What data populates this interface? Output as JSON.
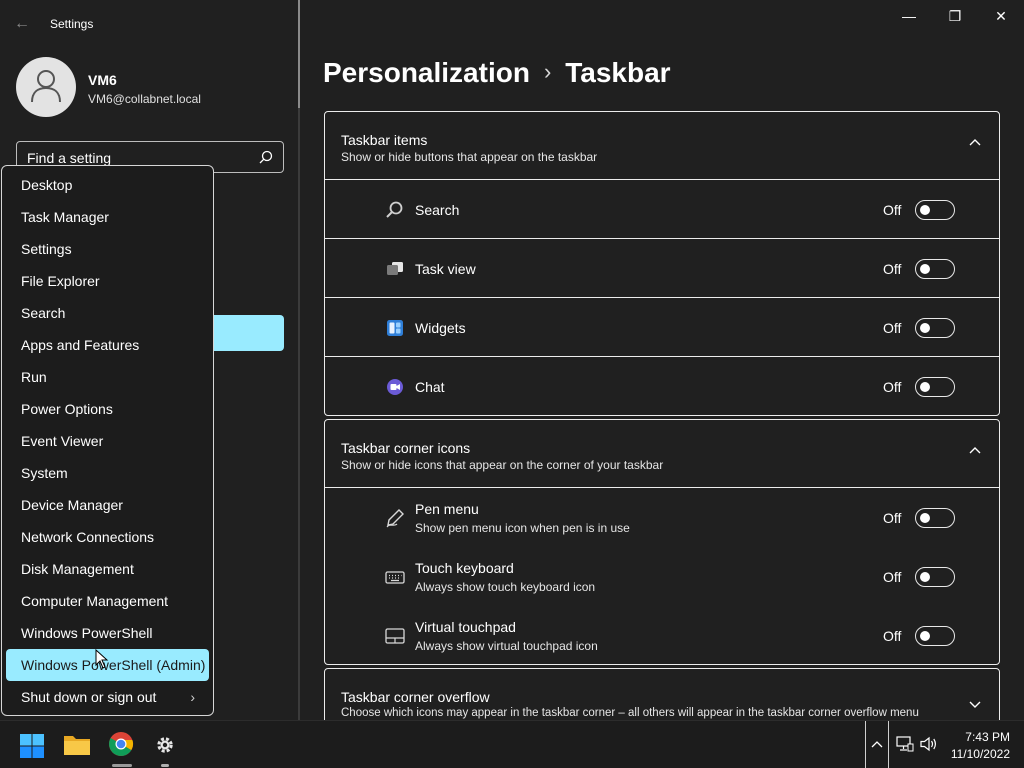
{
  "app": {
    "title": "Settings",
    "back": "←"
  },
  "window_controls": {
    "minimize": "—",
    "restore": "❐",
    "close": "✕"
  },
  "user": {
    "name": "VM6",
    "email": "VM6@collabnet.local"
  },
  "search": {
    "placeholder": "Find a setting"
  },
  "context_menu": {
    "items": [
      "Desktop",
      "Task Manager",
      "Settings",
      "File Explorer",
      "Search",
      "Apps and Features",
      "Run",
      "Power Options",
      "Event Viewer",
      "System",
      "Device Manager",
      "Network Connections",
      "Disk Management",
      "Computer Management",
      "Windows PowerShell",
      "Windows PowerShell (Admin)",
      "Shut down or sign out"
    ],
    "active_index": 15,
    "submenu_arrow": "›"
  },
  "breadcrumb": {
    "parent": "Personalization",
    "separator": "›",
    "current": "Taskbar"
  },
  "sections": {
    "taskbar_items": {
      "title": "Taskbar items",
      "subtitle": "Show or hide buttons that appear on the taskbar",
      "rows": [
        {
          "label": "Search",
          "state": "Off",
          "icon": "search-icon"
        },
        {
          "label": "Task view",
          "state": "Off",
          "icon": "task-view-icon"
        },
        {
          "label": "Widgets",
          "state": "Off",
          "icon": "widgets-icon"
        },
        {
          "label": "Chat",
          "state": "Off",
          "icon": "chat-icon"
        }
      ]
    },
    "corner_icons": {
      "title": "Taskbar corner icons",
      "subtitle": "Show or hide icons that appear on the corner of your taskbar",
      "rows": [
        {
          "label": "Pen menu",
          "desc": "Show pen menu icon when pen is in use",
          "state": "Off",
          "icon": "pen-icon"
        },
        {
          "label": "Touch keyboard",
          "desc": "Always show touch keyboard icon",
          "state": "Off",
          "icon": "keyboard-icon"
        },
        {
          "label": "Virtual touchpad",
          "desc": "Always show virtual touchpad icon",
          "state": "Off",
          "icon": "touchpad-icon"
        }
      ]
    },
    "corner_overflow": {
      "title": "Taskbar corner overflow",
      "subtitle": "Choose which icons may appear in the taskbar corner – all others will appear in the taskbar corner overflow menu"
    }
  },
  "taskbar": {
    "apps": [
      "start-icon",
      "file-explorer-icon",
      "chrome-icon",
      "settings-icon"
    ],
    "tray_arrow": "^",
    "time": "7:43 PM",
    "date": "11/10/2022"
  },
  "colors": {
    "accent": "#99ebff",
    "background": "#202020",
    "taskbar": "#1c1c1c",
    "border": "#ececec"
  }
}
